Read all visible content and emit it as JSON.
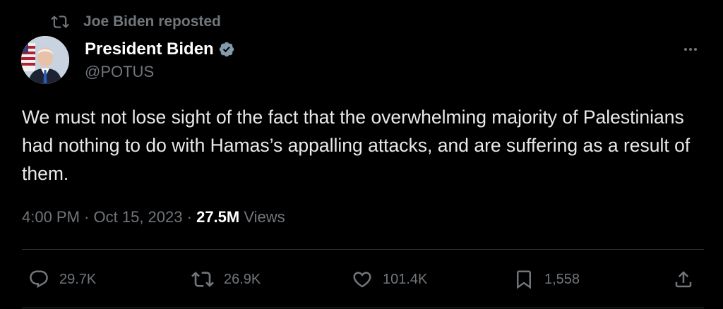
{
  "repost": {
    "label": "Joe Biden reposted",
    "icon": "repost-icon"
  },
  "author": {
    "display_name": "President Biden",
    "handle": "@POTUS",
    "verified_icon": "verified-badge-icon",
    "verified_color": "#829aab"
  },
  "tweet": {
    "text": "We must not lose sight of the fact that the overwhelming majority of Palestinians had nothing to do with Hamas’s appalling attacks, and are suffering as a result of them.",
    "time": "4:00 PM",
    "separator": "·",
    "date": "Oct 15, 2023",
    "views_count": "27.5M",
    "views_label": "Views"
  },
  "actions": {
    "replies": "29.7K",
    "reposts": "26.9K",
    "likes": "101.4K",
    "bookmarks": "1,558"
  },
  "colors": {
    "background": "#000000",
    "text": "#e7e9ea",
    "secondary": "#71767b",
    "divider": "#2f3336"
  }
}
